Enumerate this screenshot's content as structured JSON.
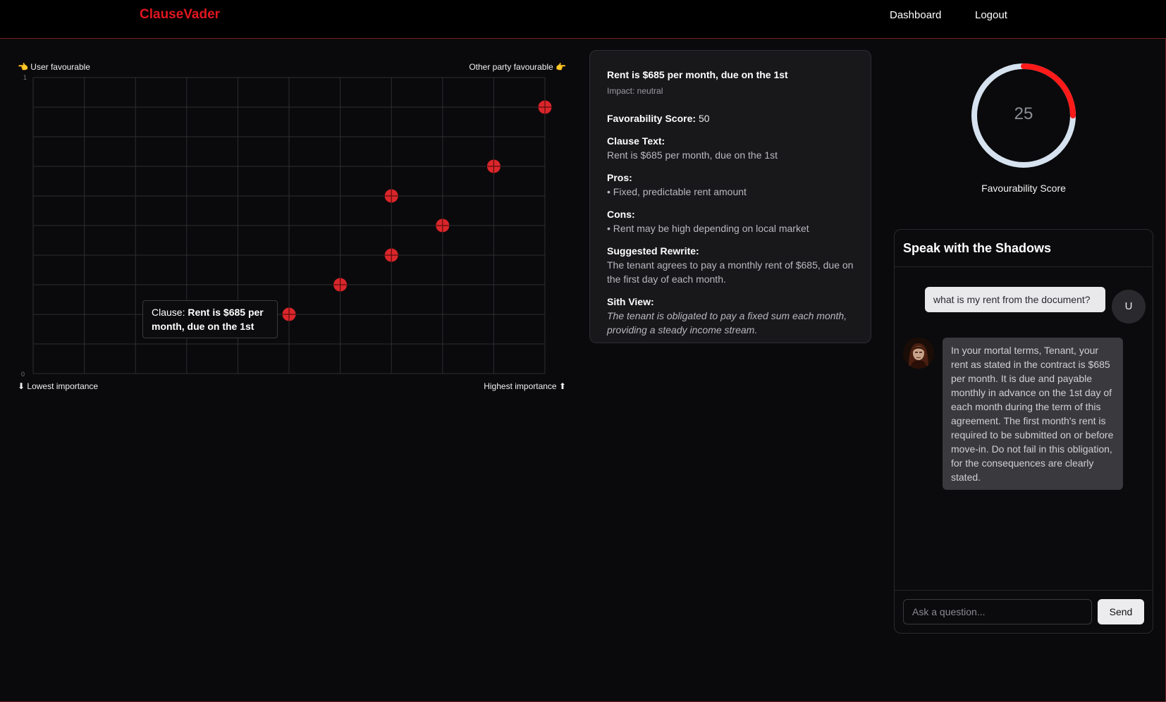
{
  "header": {
    "brand": "ClauseVader",
    "nav": {
      "dashboard": "Dashboard",
      "logout": "Logout"
    }
  },
  "chart": {
    "top_left_label": "👈 User favourable",
    "top_right_label": "Other party favourable 👉",
    "bottom_left_label": "⬇ Lowest importance",
    "bottom_right_label": "Highest importance ⬆",
    "y_tick_top": "1",
    "y_tick_bottom": "0",
    "tooltip_prefix": "Clause:",
    "tooltip_clause": "Rent is $685 per month, due on the 1st",
    "marker_color": "#d9262b"
  },
  "chart_data": {
    "type": "scatter",
    "xlim": [
      0,
      1
    ],
    "ylim": [
      0,
      1
    ],
    "grid": true,
    "points": [
      {
        "x": 0.5,
        "y": 0.2
      },
      {
        "x": 0.6,
        "y": 0.3
      },
      {
        "x": 0.7,
        "y": 0.4
      },
      {
        "x": 0.8,
        "y": 0.5
      },
      {
        "x": 0.7,
        "y": 0.6
      },
      {
        "x": 0.9,
        "y": 0.7
      },
      {
        "x": 1.0,
        "y": 0.9
      }
    ]
  },
  "detail": {
    "title": "Rent is $685 per month, due on the 1st",
    "impact": "Impact: neutral",
    "score_label": "Favorability Score:",
    "score_value": "50",
    "clause_label": "Clause Text:",
    "clause_text": "Rent is $685 per month, due on the 1st",
    "pros_label": "Pros:",
    "pros": [
      "Fixed, predictable rent amount"
    ],
    "cons_label": "Cons:",
    "cons": [
      "Rent may be high depending on local market"
    ],
    "rewrite_label": "Suggested Rewrite:",
    "rewrite_text": "The tenant agrees to pay a monthly rent of $685, due on the first day of each month.",
    "sith_label": "Sith View:",
    "sith_text": "The tenant is obligated to pay a fixed sum each month, providing a steady income stream."
  },
  "gauge": {
    "value": "25",
    "fraction": 0.25,
    "label": "Favourability Score",
    "fill_color": "#ff1a1a",
    "track_color": "#d6e2ef"
  },
  "chat": {
    "title": "Speak with the Shadows",
    "user_message": "what is my rent from the document?",
    "user_avatar": "U",
    "bot_message": "In your mortal terms, Tenant, your rent as stated in the contract is $685 per month. It is due and payable monthly in advance on the 1st day of each month during the term of this agreement. The first month's rent is required to be submitted on or before move-in. Do not fail in this obligation, for the consequences are clearly stated.",
    "input_placeholder": "Ask a question...",
    "send_label": "Send"
  }
}
